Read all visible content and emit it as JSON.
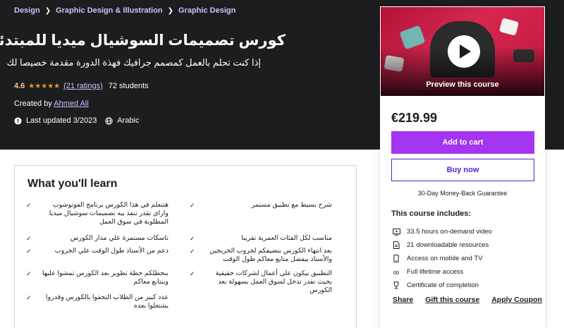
{
  "breadcrumb": [
    "Design",
    "Graphic Design & Illustration",
    "Graphic Design"
  ],
  "course": {
    "title": "كورس تصميمات السوشيال ميديا للمبتدئين",
    "subtitle": "إذا كنت تحلم بالعمل كمصمم جرافيك فهذة الدورة مقدمة خصيصا لك",
    "rating": "4.6",
    "stars": "★★★★★",
    "ratings_count": "(21 ratings)",
    "students": "72 students",
    "created_by_label": "Created by",
    "instructor": "Ahmed Ali",
    "last_updated": "Last updated 3/2023",
    "language": "Arabic"
  },
  "sidebar": {
    "preview_label": "Preview this course",
    "price": "€219.99",
    "add_to_cart": "Add to cart",
    "buy_now": "Buy now",
    "guarantee": "30-Day Money-Back Guarantee",
    "includes_title": "This course includes:",
    "includes": [
      {
        "icon": "video-icon",
        "text": "33.5 hours on-demand video"
      },
      {
        "icon": "file-icon",
        "text": "21 downloadable resources"
      },
      {
        "icon": "mobile-icon",
        "text": "Access on mobile and TV"
      },
      {
        "icon": "infinity-icon",
        "text": "Full lifetime access"
      },
      {
        "icon": "trophy-icon",
        "text": "Certificate of completion"
      }
    ],
    "links": {
      "share": "Share",
      "gift": "Gift this course",
      "coupon": "Apply Coupon"
    }
  },
  "learn": {
    "heading": "What you'll learn",
    "left": [
      "هنتعلم في هذا الكورس برنامج الفوتوشوب واراي تقدر تنفذ بيه تصميمات سوشيال ميديا المطلوبة في سوق العمل",
      "تاسكات مستمرة علي مدار الكورس",
      "دعم من الأستاذ طول الوقت علي الجروب",
      "بنحطلكم خطة تطوير بعد الكورس تمشوا عليها وبنتابع معاكم",
      "عدد كبير من الطلاب التحقوا بالكورس وقدروا يشتغلوا بعده"
    ],
    "right": [
      "شرح بسيط مع تطبيق مستمر",
      "مناسب لكل الفئات العمرية تقريبا",
      "بعد انتهاء الكورس بنضيفكم لجروب الخريجين والأستاذ بيفضل متابع معاكم طول الوقت",
      "التطبيق بيكون علي أعمال لشركات حقيقية بحيث تقدر تدخل لسوق العمل بسهولة بعد الكورس"
    ]
  }
}
